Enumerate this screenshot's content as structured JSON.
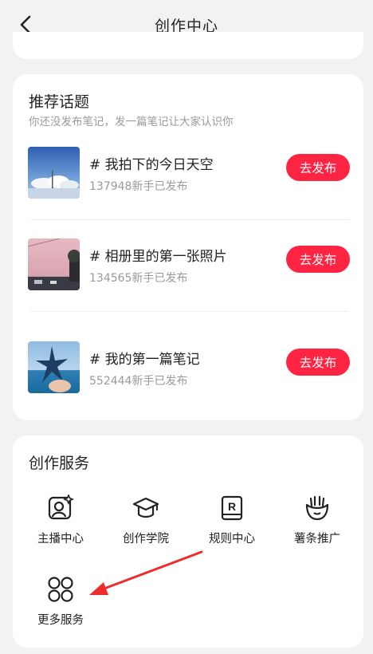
{
  "header": {
    "title": "创作中心"
  },
  "topics": {
    "title": "推荐话题",
    "subtitle": "你还没发布笔记，发一篇笔记让大家认识你",
    "items": [
      {
        "name": "# 我拍下的今日天空",
        "count": "137948新手已发布",
        "button": "去发布"
      },
      {
        "name": "# 相册里的第一张照片",
        "count": "134565新手已发布",
        "button": "去发布"
      },
      {
        "name": "# 我的第一篇笔记",
        "count": "552444新手已发布",
        "button": "去发布"
      }
    ]
  },
  "services": {
    "title": "创作服务",
    "items": [
      {
        "label": "主播中心",
        "icon": "host-icon"
      },
      {
        "label": "创作学院",
        "icon": "graduation-cap-icon"
      },
      {
        "label": "规则中心",
        "icon": "rules-book-icon"
      },
      {
        "label": "薯条推广",
        "icon": "fries-icon"
      },
      {
        "label": "更多服务",
        "icon": "more-grid-icon"
      }
    ]
  },
  "colors": {
    "accent": "#ff2442",
    "background": "#f2f2f2",
    "card": "#ffffff"
  }
}
